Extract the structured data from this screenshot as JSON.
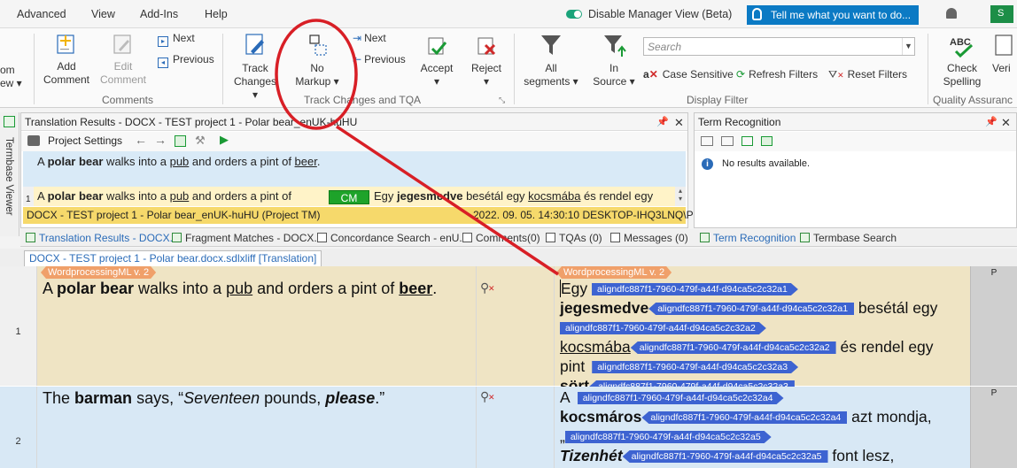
{
  "menubar": {
    "items": [
      "Advanced",
      "View",
      "Add-Ins",
      "Help"
    ],
    "disable_manager_view": "Disable Manager View (Beta)",
    "tell_me": "Tell me what you want to do...",
    "avatar": "S"
  },
  "ribbon": {
    "comm_partial_1": "om",
    "comm_partial_2": "ew",
    "add_comment": [
      "Add",
      "Comment"
    ],
    "edit_comment": [
      "Edit",
      "Comment"
    ],
    "comments_next": "Next",
    "comments_previous": "Previous",
    "comments_group": "Comments",
    "track_changes": [
      "Track",
      "Changes"
    ],
    "no_markup": [
      "No",
      "Markup"
    ],
    "track_next": "Next",
    "track_previous": "Previous",
    "accept": "Accept",
    "reject": "Reject",
    "track_group": "Track Changes and TQA",
    "all_segments": [
      "All",
      "segments"
    ],
    "in_source": [
      "In",
      "Source"
    ],
    "search_placeholder": "Search",
    "case_sensitive": "Case Sensitive",
    "refresh_filters": "Refresh Filters",
    "reset_filters": "Reset Filters",
    "display_filter_group": "Display Filter",
    "check_spelling": [
      "Check",
      "Spelling"
    ],
    "verify_partial": "Veri",
    "qa_group": "Quality Assuranc"
  },
  "termbase_viewer": "Termbase Viewer",
  "translation_results": {
    "title": "Translation Results - DOCX - TEST project 1 - Polar bear_enUK-huHU",
    "project_settings": "Project Settings",
    "source": {
      "a": "A ",
      "polar_bear": "polar bear",
      "walks": " walks into a ",
      "pub": "pub",
      "orders": " and orders a pint of ",
      "beer": "beer",
      "end": "."
    },
    "row_num": "1",
    "match_source": {
      "a": "A ",
      "polar_bear": "polar bear",
      "walks": " walks into a ",
      "pub": "pub",
      "orders": " and orders a pint of"
    },
    "cm": "CM",
    "match_target": {
      "egy": "Egy ",
      "jegesmedve": "jegesmedve",
      "besetal": " besétál egy ",
      "kocsmaba": "kocsmába",
      "rest": " és rendel egy"
    },
    "status_left": "DOCX - TEST project 1 - Polar bear_enUK-huHU (Project TM)",
    "status_right": "2022. 09. 05. 14:30:10   DESKTOP-IHQ3LNQ\\Peti"
  },
  "term_recognition": {
    "title": "Term Recognition",
    "message": "No results available."
  },
  "tabs": {
    "translation_results": "Translation Results - DOCX...",
    "fragment_matches": "Fragment Matches - DOCX...",
    "concordance": "Concordance Search - enU...",
    "comments": "Comments(0)",
    "tqas": "TQAs (0)",
    "messages": "Messages (0)",
    "term_recognition": "Term Recognition",
    "termbase_search": "Termbase Search"
  },
  "doc_tab": "DOCX - TEST project 1 - Polar bear.docx.sdlxliff [Translation]",
  "editor": {
    "tag_label": "WordprocessingML v. 2",
    "seg1": {
      "num": "1",
      "src": {
        "a": "A ",
        "polar_bear": "polar bear",
        "walks": " walks into a ",
        "pub": "pub",
        "orders": " and orders a pint of ",
        "beer": "beer",
        "end": "."
      },
      "tgt": {
        "egy": "Egy",
        "jegesmedve": "jegesmedve",
        "besetal": " besétál egy",
        "kocsmaba": "kocsmába",
        "es": " és rendel egy",
        "pint": "pint",
        "sort": "sört",
        "end": "."
      },
      "status": "P"
    },
    "seg2": {
      "num": "2",
      "src": {
        "the": "The ",
        "barman": "barman",
        "says": " says, “",
        "seventeen": "Seventeen",
        "pounds": " pounds, ",
        "please": "please",
        "end": ".”"
      },
      "tgt": {
        "a": "A",
        "kocsmaros": "kocsmáros",
        "azt": " azt mondja,",
        "quote": "„",
        "tizenhet": "Tizenhét",
        "font": " font lesz,"
      },
      "status": "P"
    },
    "tags": {
      "t1": "aligndfc887f1-7960-479f-a44f-d94ca5c2c32a1",
      "t2": "aligndfc887f1-7960-479f-a44f-d94ca5c2c32a2",
      "t3": "aligndfc887f1-7960-479f-a44f-d94ca5c2c32a3",
      "t4": "aligndfc887f1-7960-479f-a44f-d94ca5c2c32a4",
      "t5": "aligndfc887f1-7960-479f-a44f-d94ca5c2c32a5"
    }
  },
  "colors": {
    "accent_blue": "#0b7ac4",
    "tag_blue": "#3d63d1",
    "tag_orange": "#f0a06a",
    "segment_source_bg": "#efe4c4",
    "annotation_red": "#d81f26"
  }
}
